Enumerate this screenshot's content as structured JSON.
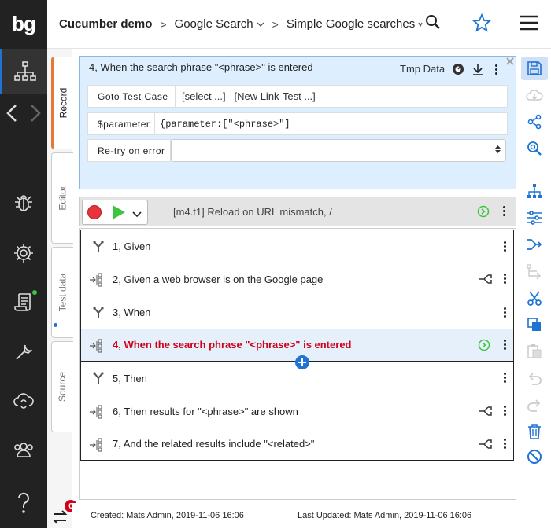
{
  "app": {
    "logo": "bg",
    "breadcrumb": {
      "project": "Cucumber demo",
      "sep1": ">",
      "suite": "Google Search",
      "sep2": ">",
      "testcase": "Simple Google searches"
    }
  },
  "sidebar": {
    "badge_color": "#3ec43e"
  },
  "tabs": [
    {
      "label": "Record"
    },
    {
      "label": "Editor"
    },
    {
      "label": "Test data"
    },
    {
      "label": "Source"
    }
  ],
  "step_header": {
    "title": "4, When the search phrase \"<phrase>\" is entered",
    "tmp_data": "Tmp Data",
    "rows": [
      {
        "label": "Goto Test Case",
        "value": "[select ...]   [New Link-Test ...]"
      },
      {
        "label": "$parameter",
        "value": "{parameter:[\"<phrase>\"]"
      },
      {
        "label": "Re-try on error",
        "value": ""
      }
    ]
  },
  "run_bar": {
    "status_text": "[m4.t1] Reload on URL mismatch, /"
  },
  "steps": [
    {
      "label": "1, Given",
      "kind": "branch"
    },
    {
      "label": "2, Given a web browser is on the Google page",
      "kind": "call"
    },
    {
      "label": "3, When",
      "kind": "branch"
    },
    {
      "label": "4, When the search phrase \"<phrase>\" is entered",
      "kind": "call"
    },
    {
      "label": "5, Then",
      "kind": "branch"
    },
    {
      "label": "6, Then results for \"<phrase>\" are shown",
      "kind": "call"
    },
    {
      "label": "7, And the related results include \"<related>\"",
      "kind": "call"
    }
  ],
  "footer": {
    "created": "Created: Mats Admin, 2019-11-06 16:06",
    "updated": "Last Updated: Mats Admin, 2019-11-06 16:06",
    "notif_count": "0"
  },
  "colors": {
    "accent": "#1e73d4",
    "selected_text": "#d0021b",
    "play": "#3ec43e",
    "record": "#e8333a"
  }
}
